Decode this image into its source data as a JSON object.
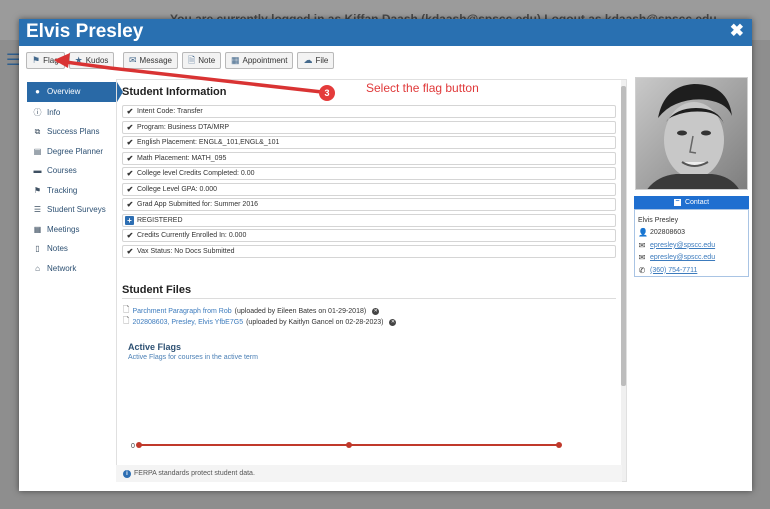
{
  "backdrop": {
    "login_notice": "You are currently logged in as Kiffan Daash (kdaash@spscc.edu)    Logout as kdaash@spscc.edu"
  },
  "modal": {
    "title": "Elvis Presley",
    "close_glyph": "✖"
  },
  "toolbar": {
    "flag": "Flag",
    "kudos": "Kudos",
    "message": "Message",
    "note": "Note",
    "appointment": "Appointment",
    "file": "File"
  },
  "sidebar": {
    "items": [
      {
        "label": "Overview",
        "icon": "user-icon"
      },
      {
        "label": "Info",
        "icon": "info-icon"
      },
      {
        "label": "Success Plans",
        "icon": "sitemap-icon"
      },
      {
        "label": "Degree Planner",
        "icon": "map-icon"
      },
      {
        "label": "Courses",
        "icon": "folder-icon"
      },
      {
        "label": "Tracking",
        "icon": "flag-icon"
      },
      {
        "label": "Student Surveys",
        "icon": "list-icon"
      },
      {
        "label": "Meetings",
        "icon": "calendar-icon"
      },
      {
        "label": "Notes",
        "icon": "file-icon"
      },
      {
        "label": "Network",
        "icon": "institution-icon"
      }
    ]
  },
  "student_info": {
    "title": "Student Information",
    "rows": [
      "Intent Code: Transfer",
      "Program: Business DTA/MRP",
      "English Placement: ENGL&_101,ENGL&_101",
      "Math Placement: MATH_095",
      "College level Credits Completed: 0.00",
      "College Level GPA: 0.000",
      "Grad App Submitted for: Summer 2016",
      "REGISTERED",
      "Credits Currently Enrolled In: 0.000",
      "Vax Status: No Docs Submitted"
    ]
  },
  "student_files": {
    "title": "Student Files",
    "files": [
      {
        "name": "Parchment Paragraph from Rob",
        "meta": "(uploaded by Eileen Bates on 01-29-2018)"
      },
      {
        "name": "202808603, Presley, Elvis YfbE7G5",
        "meta": "(uploaded by Kaitlyn Gancel on 02-28-2023)"
      }
    ]
  },
  "active_flags": {
    "title": "Active Flags",
    "subtitle": "Active Flags for courses in the active term"
  },
  "chart_data": {
    "type": "line",
    "y_tick": "0",
    "values": [
      0,
      0,
      0
    ],
    "color": "#c0392b"
  },
  "ferpa": "FERPA standards protect student data.",
  "contact": {
    "button": "Contact",
    "name": "Elvis Presley",
    "id": "202808603",
    "email1": "epresley@spscc.edu",
    "email2": "epresley@spscc.edu",
    "phone": "(360) 754-7711"
  },
  "annotation": {
    "number": "3",
    "text": "Select the flag button",
    "color": "#e0393a"
  }
}
